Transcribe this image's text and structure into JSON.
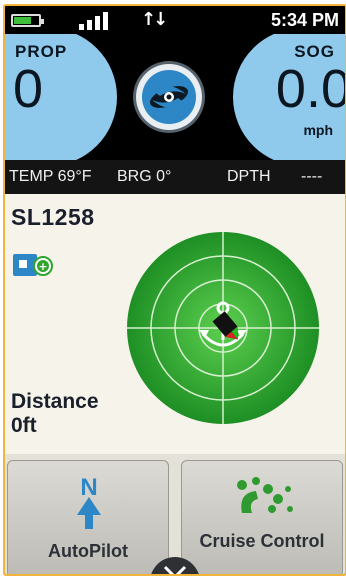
{
  "status_bar": {
    "battery_level": 0.7,
    "battery_color": "#3fbe3a",
    "signal_icon": "signal-bars-icon",
    "data_icon": "data-transfer-icon",
    "data_glyph": "↑↓",
    "time": "5:34 PM"
  },
  "gauges": {
    "prop": {
      "label": "PROP",
      "value": "0"
    },
    "sog": {
      "label": "SOG",
      "value": "0.0",
      "unit": "mph"
    },
    "center_button_icon": "propeller-icon",
    "gauge_color": "#8fc9ec"
  },
  "info_bar": {
    "temp": "TEMP 69°F",
    "brg": "BRG  0°",
    "dpth_label": "DPTH",
    "dpth_value": "----"
  },
  "main": {
    "device_id": "SL1258",
    "remote_icon": "remote-link-icon",
    "radar_icon": "anchor-radar-icon",
    "radar_color": "#2fa52f",
    "distance_label": "Distance",
    "distance_value": "0ft"
  },
  "buttons": {
    "autopilot": {
      "label": "AutoPilot",
      "icon": "north-arrow-icon"
    },
    "cruise": {
      "label": "Cruise Control",
      "icon": "cruise-control-icon"
    },
    "expand_icon": "chevron-down-icon"
  },
  "colors": {
    "accent": "#2d86c5",
    "frame": "#f2b43a"
  }
}
